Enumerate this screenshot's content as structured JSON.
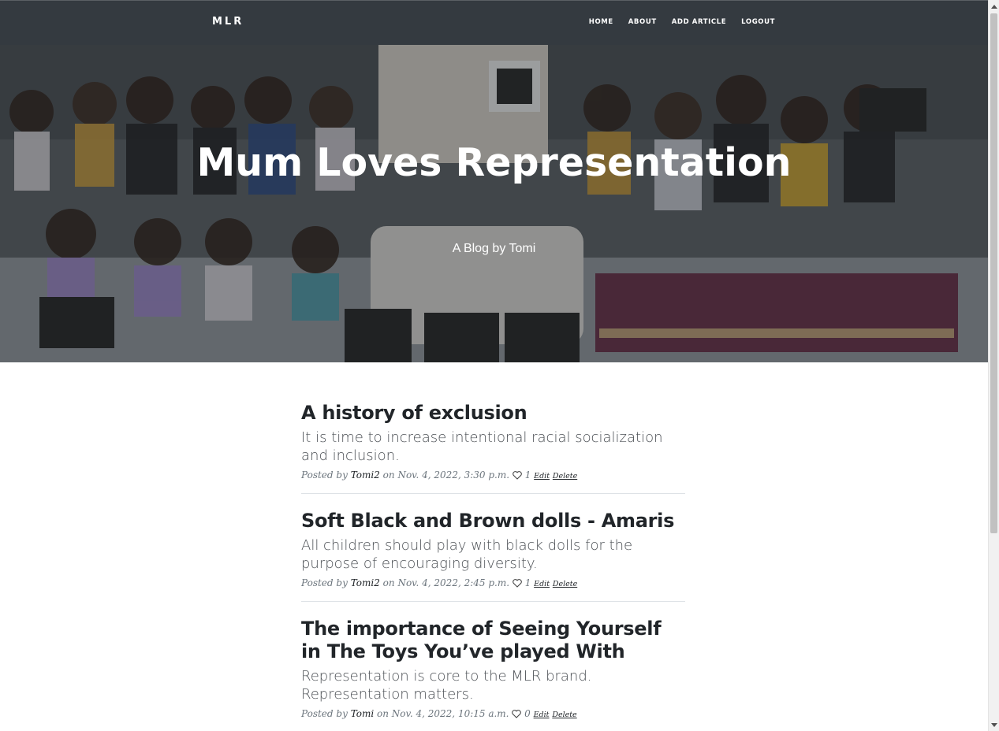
{
  "navbar": {
    "brand": "MLR",
    "links": [
      "HOME",
      "ABOUT",
      "ADD ARTICLE",
      "LOGOUT"
    ]
  },
  "hero": {
    "title": "Mum Loves Representation",
    "subtitle": "A Blog by Tomi"
  },
  "posts": [
    {
      "title": "A history of exclusion",
      "subtitle": "It is time to increase intentional racial socialization and inclusion.",
      "posted_by_label": "Posted by",
      "author": "Tomi2",
      "date": "on Nov. 4, 2022, 3:30 p.m.",
      "likes": "1",
      "edit": "Edit",
      "delete": "Delete"
    },
    {
      "title": "Soft Black and Brown dolls - Amaris",
      "subtitle": "All children should play with black dolls for the purpose of encouraging diversity.",
      "posted_by_label": "Posted by",
      "author": "Tomi2",
      "date": "on Nov. 4, 2022, 2:45 p.m.",
      "likes": "1",
      "edit": "Edit",
      "delete": "Delete"
    },
    {
      "title": "The importance of Seeing Yourself in The Toys You’ve played With",
      "subtitle": "Representation is core to the MLR brand. Representation matters.",
      "posted_by_label": "Posted by",
      "author": "Tomi",
      "date": "on Nov. 4, 2022, 10:15 a.m.",
      "likes": "0",
      "edit": "Edit",
      "delete": "Delete"
    }
  ],
  "colors": {
    "navbar_bg": "#343a40",
    "text_dark": "#212529",
    "text_muted": "#6c757d"
  }
}
